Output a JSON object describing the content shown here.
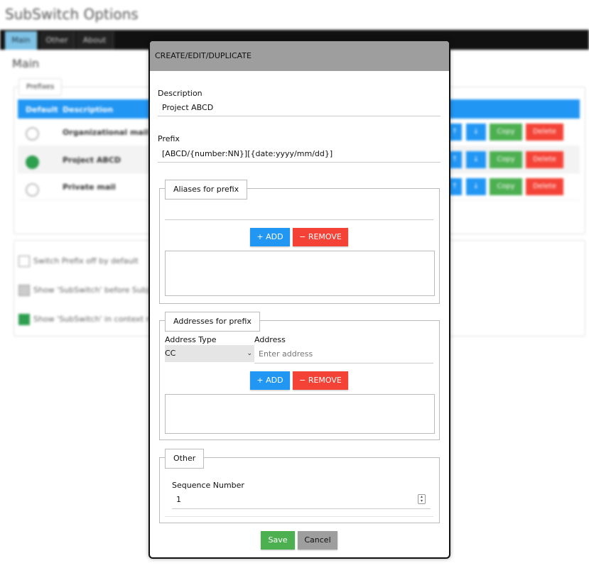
{
  "background": {
    "title": "SubSwitch Options",
    "tabs": [
      "Main",
      "Other",
      "About"
    ],
    "section_title": "Main",
    "prefixes_legend": "Prefixes",
    "table_headers": [
      "Default",
      "Description"
    ],
    "rows": [
      {
        "description": "Organizational mail",
        "default": false
      },
      {
        "description": "Project ABCD",
        "default": true
      },
      {
        "description": "Private mail",
        "default": false
      }
    ],
    "row_buttons": {
      "copy": "Copy",
      "delete": "Delete",
      "up": "↑",
      "down": "↓"
    },
    "checkboxes": [
      {
        "label": "Switch Prefix off by default",
        "checked": false
      },
      {
        "label": "Show 'SubSwitch' before Subject",
        "checked": true
      },
      {
        "label": "Show 'SubSwitch' in context menu",
        "checked": true
      }
    ]
  },
  "modal": {
    "title": "CREATE/EDIT/DUPLICATE",
    "description": {
      "label": "Description",
      "value": "Project ABCD"
    },
    "prefix": {
      "label": "Prefix",
      "value": "[ABCD/{number:NN}][{date:yyyy/mm/dd}]"
    },
    "aliases": {
      "legend": "Aliases for prefix",
      "add_label": "+ ADD",
      "remove_label": "− REMOVE"
    },
    "addresses": {
      "legend": "Addresses for prefix",
      "type_label": "Address Type",
      "type_value": "CC",
      "address_label": "Address",
      "address_placeholder": "Enter address",
      "add_label": "+ ADD",
      "remove_label": "− REMOVE"
    },
    "other": {
      "legend": "Other",
      "sequence_label": "Sequence Number",
      "sequence_value": "1"
    },
    "save_label": "Save",
    "cancel_label": "Cancel"
  },
  "colors": {
    "accent": "#2196f3",
    "danger": "#f44336",
    "success": "#4caf50",
    "header": "#9e9e9e"
  }
}
